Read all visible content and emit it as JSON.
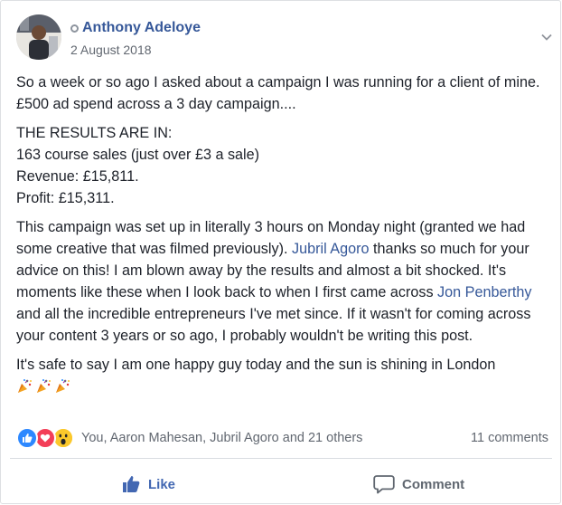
{
  "post": {
    "author": "Anthony Adeloye",
    "date": "2 August 2018",
    "paragraphs": {
      "p1": "So a week or so ago I asked about a campaign I was running for a client of mine. £500 ad spend across a 3 day campaign....",
      "results_heading": "THE RESULTS ARE IN:",
      "results_line1": "163 course sales (just over £3 a sale)",
      "results_line2": "Revenue: £15,811.",
      "results_line3": "Profit: £15,311.",
      "p3_a": "This campaign was set up in literally 3 hours on Monday night (granted we had some creative that was filmed previously). ",
      "p3_link1": "Jubril Agoro",
      "p3_b": " thanks so much for your advice on this! I am blown away by the results and almost a bit shocked. It's moments like these when I look back to when I first came across ",
      "p3_link2": "Jon Penberthy",
      "p3_c": " and all the incredible entrepreneurs I've met since. If it wasn't for coming across your content 3 years or so ago, I probably wouldn't be writing this post.",
      "p4": "It's safe to say I am one happy guy today and the sun is shining in London"
    },
    "emojis": [
      "party-popper-icon",
      "party-popper-icon",
      "party-popper-icon"
    ]
  },
  "reactions": {
    "icons": [
      "like-reaction",
      "love-reaction",
      "wow-reaction"
    ],
    "names": "You, Aaron Mahesan, Jubril Agoro and 21 others",
    "comments": "11 comments"
  },
  "actions": {
    "like_label": "Like",
    "comment_label": "Comment"
  },
  "colors": {
    "link": "#365899",
    "like_blue": "#4267b2",
    "love_red": "#f33e58",
    "wow_yellow": "#fbc82b"
  }
}
